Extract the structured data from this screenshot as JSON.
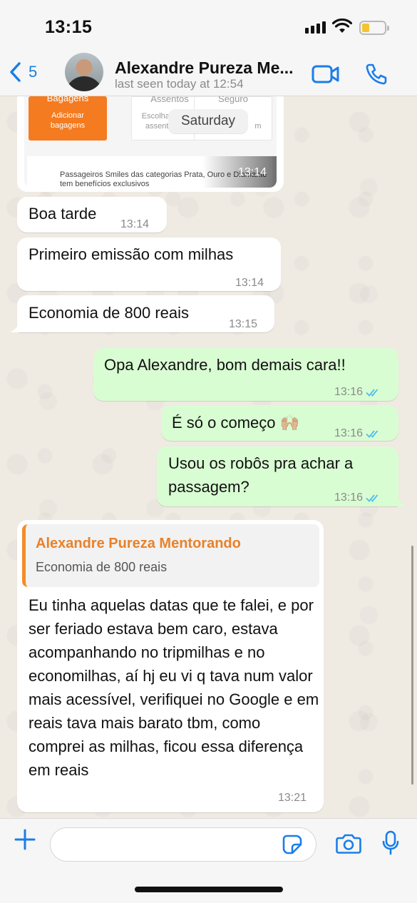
{
  "status_bar": {
    "time": "13:15"
  },
  "header": {
    "back_count": "5",
    "contact_name": "Alexandre Pureza Me...",
    "last_seen": "last seen today at 12:54"
  },
  "image_message": {
    "tile1_title": "Bagagens",
    "tile1_sub": "Adicionar bagagens",
    "tile2_title": "Assentos",
    "tile2_sub": "Escolha de assentos",
    "tile3_title": "Seguro",
    "tile3_sub": "m",
    "footer_text": "Passageiros Smiles das categorias Prata, Ouro e Diamante tem benefícios exclusivos",
    "time": "13:14"
  },
  "date_separator": "Saturday",
  "messages": [
    {
      "text": "Boa tarde",
      "time": "13:14",
      "direction": "in"
    },
    {
      "text": "Primeiro emissão com milhas",
      "time": "13:14",
      "direction": "in"
    },
    {
      "text": "Economia de 800 reais",
      "time": "13:15",
      "direction": "in"
    },
    {
      "text": "Opa Alexandre, bom demais cara!!",
      "time": "13:16",
      "direction": "out"
    },
    {
      "text": "É só o começo 🙌🏼",
      "time": "13:16",
      "direction": "out"
    },
    {
      "text": "Usou os robôs pra achar a passagem?",
      "time": "13:16",
      "direction": "out"
    }
  ],
  "reply_message": {
    "quoted_author": "Alexandre Pureza Mentorando",
    "quoted_text": "Economia de 800 reais",
    "text": "Eu tinha aquelas datas que te falei, e por ser feriado estava bem caro, estava acompanhando no tripmilhas e no economilhas, aí hj eu vi q tava num valor mais acessível, verifiquei no Google e em reais tava mais barato tbm, como comprei as milhas, ficou essa diferença em reais",
    "time": "13:21"
  },
  "input": {
    "value": "",
    "placeholder": ""
  },
  "colors": {
    "accent": "#1a7ee8",
    "outgoing_bubble": "#d9fdd3",
    "incoming_bubble": "#ffffff",
    "quote_author": "#e8812a",
    "read_ticks": "#53bdeb"
  }
}
